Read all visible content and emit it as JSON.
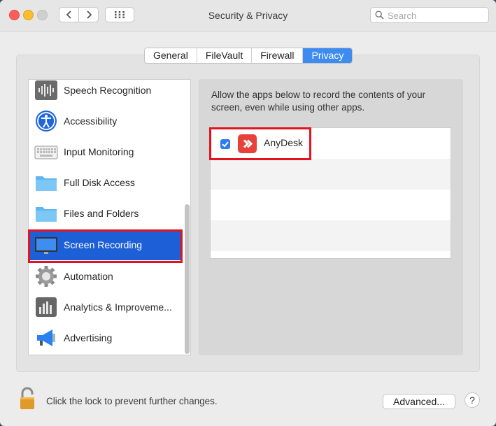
{
  "window": {
    "title": "Security & Privacy"
  },
  "search": {
    "placeholder": "Search"
  },
  "tabs": [
    {
      "label": "General",
      "active": false
    },
    {
      "label": "FileVault",
      "active": false
    },
    {
      "label": "Firewall",
      "active": false
    },
    {
      "label": "Privacy",
      "active": true
    }
  ],
  "sidebar": {
    "items": [
      {
        "label": "Speech Recognition",
        "icon": "waveform-icon"
      },
      {
        "label": "Accessibility",
        "icon": "accessibility-icon"
      },
      {
        "label": "Input Monitoring",
        "icon": "keyboard-icon"
      },
      {
        "label": "Full Disk Access",
        "icon": "folder-icon"
      },
      {
        "label": "Files and Folders",
        "icon": "folder-icon"
      },
      {
        "label": "Screen Recording",
        "icon": "display-icon",
        "selected": true
      },
      {
        "label": "Automation",
        "icon": "gear-icon"
      },
      {
        "label": "Analytics & Improveme...",
        "icon": "bar-chart-icon"
      },
      {
        "label": "Advertising",
        "icon": "megaphone-icon"
      }
    ]
  },
  "main": {
    "description": "Allow the apps below to record the contents of your screen, even while using other apps.",
    "apps": [
      {
        "name": "AnyDesk",
        "checked": true,
        "icon": "anydesk-icon"
      }
    ]
  },
  "footer": {
    "lock_text": "Click the lock to prevent further changes.",
    "advanced_label": "Advanced...",
    "help_label": "?"
  },
  "colors": {
    "accent": "#1c5fd6",
    "highlight_box": "#e3141e",
    "anydesk": "#e8413a"
  }
}
